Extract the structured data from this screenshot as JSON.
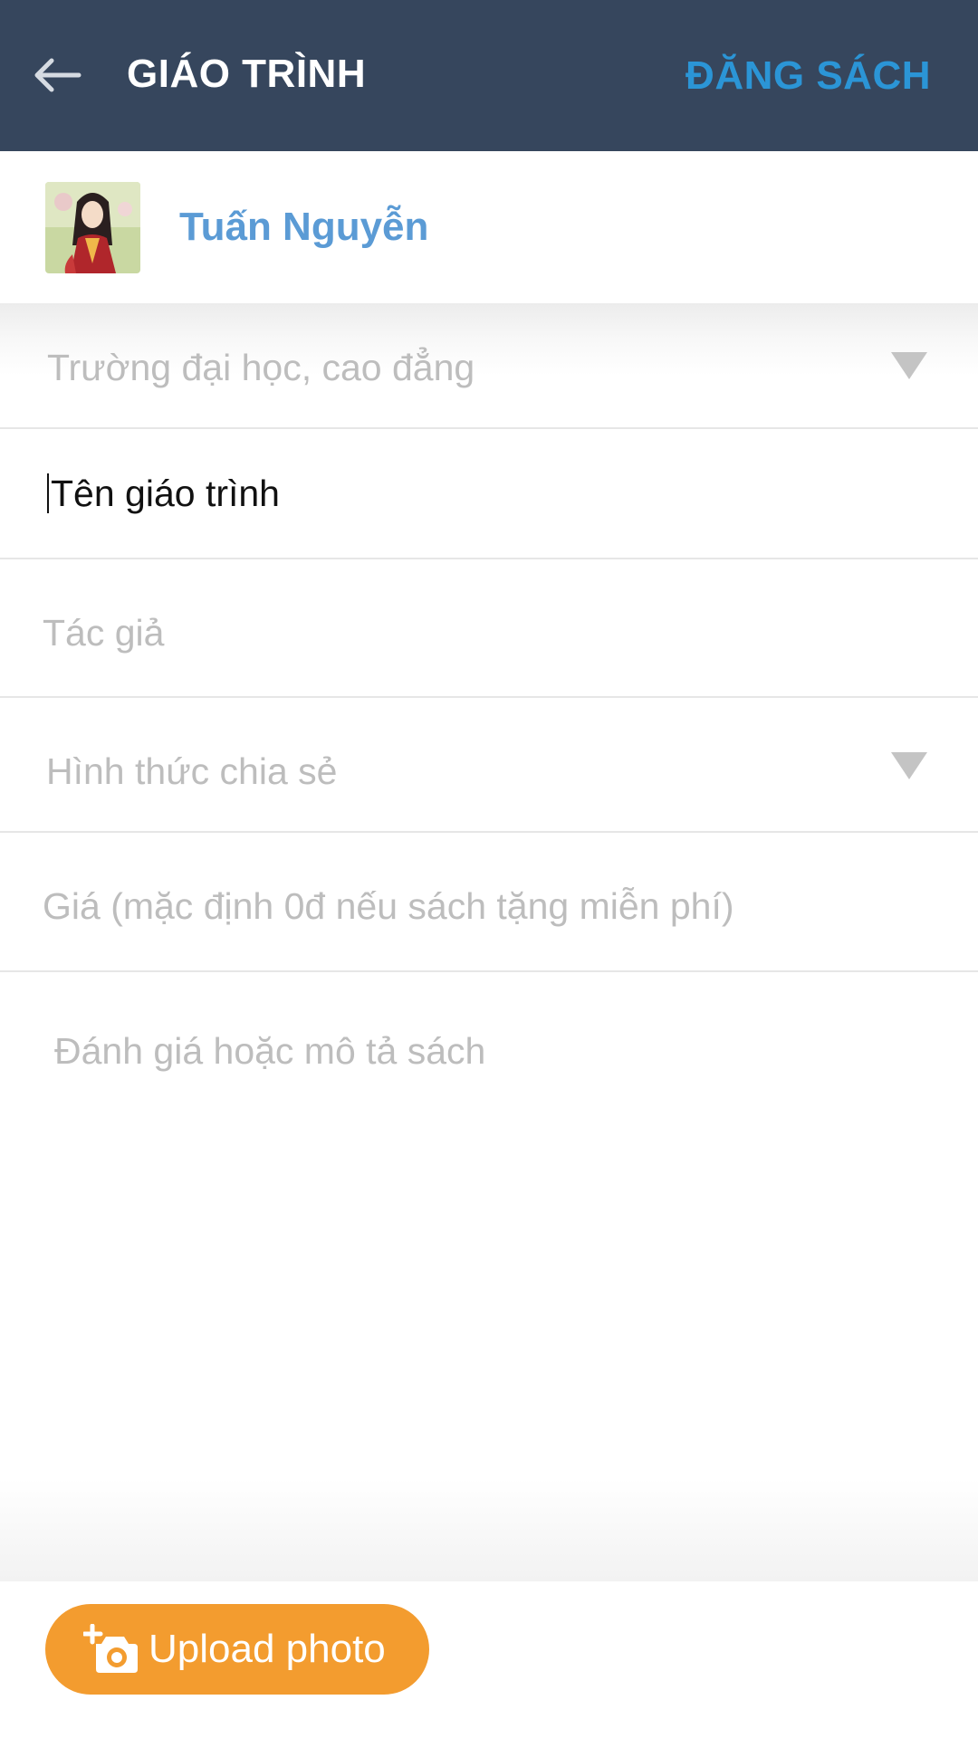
{
  "appbar": {
    "title": "GIÁO TRÌNH",
    "action_label": "ĐĂNG SÁCH"
  },
  "user": {
    "name": "Tuấn Nguyễn"
  },
  "form": {
    "school_placeholder": "Trường đại học, cao đẳng",
    "title_placeholder": "Tên giáo trình",
    "author_placeholder": "Tác giả",
    "share_type_placeholder": "Hình thức chia sẻ",
    "price_placeholder": "Giá (mặc định 0đ nếu sách tặng miễn phí)",
    "description_placeholder": "Đánh giá hoặc mô tả sách"
  },
  "upload": {
    "label": "Upload photo"
  },
  "colors": {
    "appbar_bg": "#36465d",
    "accent_blue": "#2b95d6",
    "username_blue": "#5b9bd5",
    "upload_orange": "#f39c2f"
  },
  "icons": {
    "back": "arrow-left-icon",
    "dropdown": "triangle-down-icon",
    "upload": "camera-plus-icon"
  }
}
